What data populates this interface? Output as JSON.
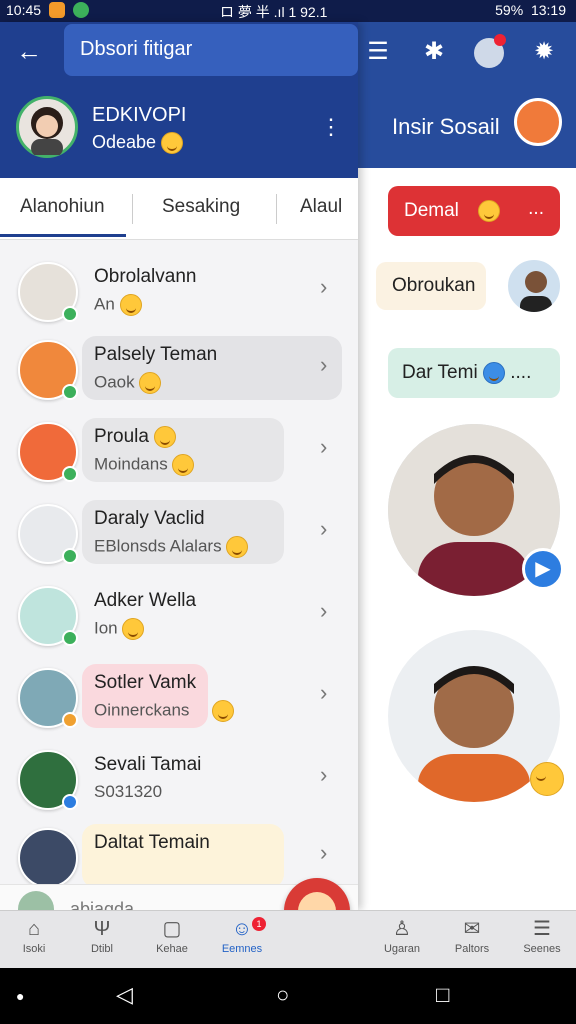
{
  "status_bar": {
    "time_left": "10:45",
    "center": "ロ 夢 半 .ıl 1 92.1",
    "battery": "59%",
    "time_right": "13:19"
  },
  "drawer": {
    "search_text": "Dbsori fitigar",
    "profile": {
      "name": "EDKIVOPI",
      "status": "Odeabe"
    },
    "tabs": [
      "Alanohiun",
      "Sesaking",
      "Alaul"
    ],
    "contacts": [
      {
        "name": "Obrolalvann",
        "sub": "An",
        "avatar_color": "#e6e1da"
      },
      {
        "name": "Palsely Teman",
        "sub": "Oaok",
        "avatar_color": "#f0883c",
        "bubble": "#e3e3e6"
      },
      {
        "name": "Proula",
        "sub": "Moindans",
        "avatar_color": "#f06a3a",
        "bubble": "#e6e6e8"
      },
      {
        "name": "Daraly Vaclid",
        "sub": "EBlonsds Alalars",
        "avatar_color": "#e8eaed",
        "bubble": "#e6e6e8"
      },
      {
        "name": "Adker Wella",
        "sub": "Ion",
        "avatar_color": "#bfe4dd"
      },
      {
        "name": "Sotler Vamk",
        "sub": "Oinnerckans",
        "avatar_color": "#7fa9b6",
        "bubble": "#fad9de"
      },
      {
        "name": "Sevali Tamai",
        "sub": "S031320",
        "avatar_color": "#2f6f3e"
      },
      {
        "name": "Daltat Temain",
        "sub": "",
        "avatar_color": "#3c4a66",
        "bubble": "#fdf3da"
      }
    ],
    "input_text": "abiagda"
  },
  "right_panel": {
    "title": "Insir Sosail",
    "red_chip": "Demal",
    "red_chip_more": "...",
    "ghost_chip": "Obroukan",
    "mint_chip": "Dar Temi",
    "mint_chip_more": "...."
  },
  "bottom_nav": [
    {
      "label": "Isoki",
      "icon": "⌂"
    },
    {
      "label": "Dtibl",
      "icon": "Ψ"
    },
    {
      "label": "Kehae",
      "icon": "▢"
    },
    {
      "label": "Eemnes",
      "icon": "☺",
      "badge": "1"
    },
    {
      "label": "Ugaran",
      "icon": "♙"
    },
    {
      "label": "Paltors",
      "icon": "✉"
    },
    {
      "label": "Seenes",
      "icon": "☰"
    }
  ],
  "colors": {
    "primary": "#1f3f8f",
    "accent_red": "#dd3235",
    "online": "#3cb05b",
    "active_nav": "#2463c6"
  }
}
